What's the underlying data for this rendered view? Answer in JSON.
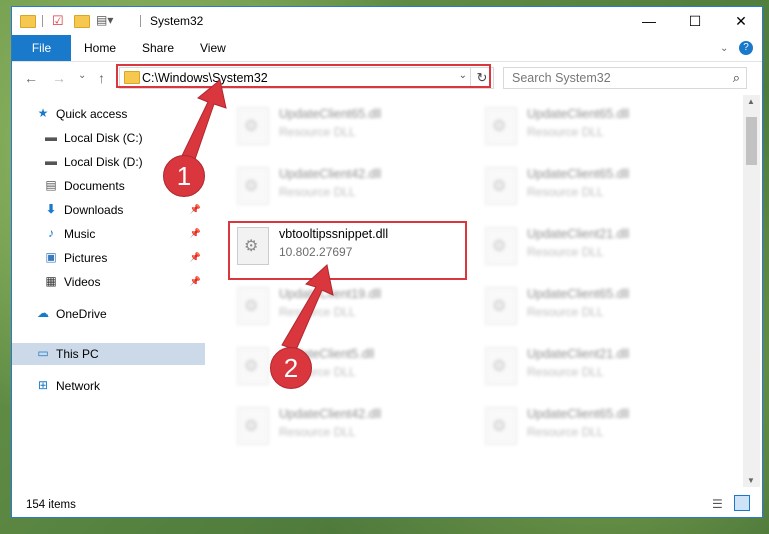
{
  "window": {
    "title": "System32",
    "minimize": "—",
    "maximize": "☐",
    "close": "✕"
  },
  "ribbon": {
    "tabs": [
      "File",
      "Home",
      "Share",
      "View"
    ],
    "help": "?"
  },
  "address": {
    "path": "C:\\Windows\\System32",
    "search_placeholder": "Search System32"
  },
  "sidebar": {
    "items": [
      {
        "label": "Quick access",
        "icon": "star-icon"
      },
      {
        "label": "Local Disk (C:)",
        "icon": "drive-icon"
      },
      {
        "label": "Local Disk (D:)",
        "icon": "drive-icon"
      },
      {
        "label": "Documents",
        "icon": "documents-icon"
      },
      {
        "label": "Downloads",
        "icon": "downloads-icon"
      },
      {
        "label": "Music",
        "icon": "music-icon"
      },
      {
        "label": "Pictures",
        "icon": "pictures-icon"
      },
      {
        "label": "Videos",
        "icon": "videos-icon"
      },
      {
        "label": "OneDrive",
        "icon": "cloud-icon"
      },
      {
        "label": "This PC",
        "icon": "computer-icon"
      },
      {
        "label": "Network",
        "icon": "network-icon"
      }
    ]
  },
  "files": {
    "left": [
      {
        "name": "UpdateClient65.dll",
        "sub": "Resource DLL"
      },
      {
        "name": "UpdateClient42.dll",
        "sub": "Resource DLL"
      },
      {
        "name": "vbtooltipssnippet.dll",
        "sub": "10.802.27697"
      },
      {
        "name": "UpdateClient19.dll",
        "sub": "Resource DLL"
      },
      {
        "name": "UpdateClient5.dll",
        "sub": "Resource DLL"
      },
      {
        "name": "UpdateClient42.dll",
        "sub": "Resource DLL"
      }
    ],
    "right": [
      {
        "name": "UpdateClient65.dll",
        "sub": "Resource DLL"
      },
      {
        "name": "UpdateClient65.dll",
        "sub": "Resource DLL"
      },
      {
        "name": "UpdateClient21.dll",
        "sub": "Resource DLL"
      },
      {
        "name": "UpdateClient65.dll",
        "sub": "Resource DLL"
      },
      {
        "name": "UpdateClient21.dll",
        "sub": "Resource DLL"
      },
      {
        "name": "UpdateClient65.dll",
        "sub": "Resource DLL"
      }
    ]
  },
  "status": {
    "item_count": "154 items"
  },
  "callouts": [
    "1",
    "2"
  ],
  "colors": {
    "accent": "#1979ca",
    "highlight": "#d9363e"
  }
}
